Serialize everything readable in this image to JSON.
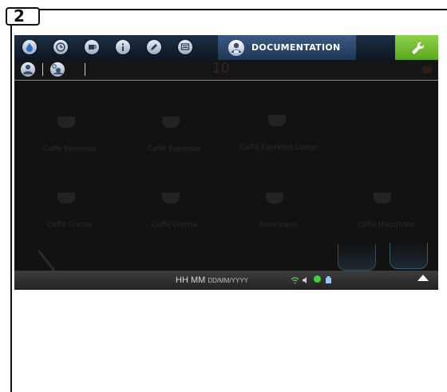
{
  "step_number": "2",
  "header": {
    "tabs": [
      {
        "icon": "water-drop-icon"
      },
      {
        "icon": "clock-icon"
      },
      {
        "icon": "cup-icon"
      },
      {
        "icon": "info-icon"
      },
      {
        "icon": "pencil-icon"
      },
      {
        "icon": "display-icon"
      }
    ],
    "active_tab": {
      "icon": "documentation-person-icon",
      "label": "DOCUMENTATION"
    },
    "settings": {
      "icon": "wrench-icon",
      "color": "#7cc23a"
    }
  },
  "subbar": {
    "icons": [
      "operator-person-icon",
      "technician-gears-icon"
    ],
    "ghost_number": "10"
  },
  "drinks_row1": [
    "Caffè Espresso",
    "Caffè Espresso",
    "Caffè Espresso Lungo"
  ],
  "drinks_row2": [
    "Caffè Crema",
    "Caffè Crema",
    "Americano",
    "Caffè Macchiato"
  ],
  "statusbar": {
    "time": "HH MM",
    "date": "DD/MM/YYYY",
    "icons": [
      "wifi-icon",
      "speaker-icon",
      "status-dot-icon",
      "usb-icon"
    ],
    "status_dot_color": "#3fd23f"
  }
}
